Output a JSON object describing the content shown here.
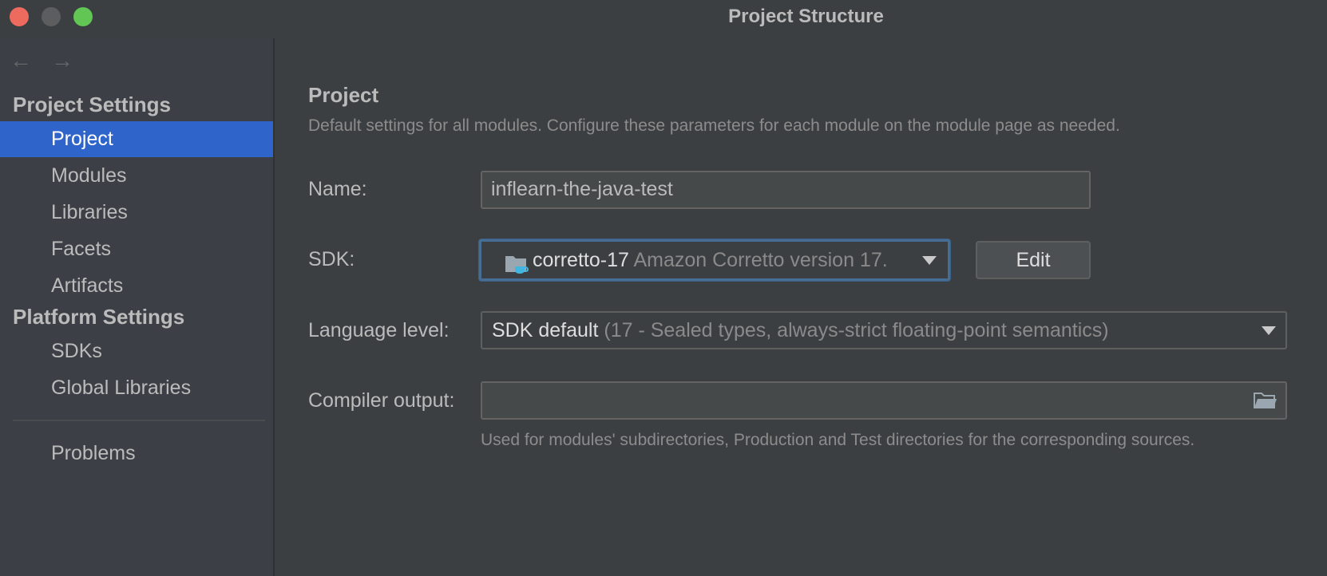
{
  "window": {
    "title": "Project Structure"
  },
  "nav": {
    "back_icon": "arrow-left-icon",
    "forward_icon": "arrow-right-icon"
  },
  "sidebar": {
    "project_settings_header": "Project Settings",
    "project_settings_items": [
      {
        "label": "Project",
        "selected": true
      },
      {
        "label": "Modules",
        "selected": false
      },
      {
        "label": "Libraries",
        "selected": false
      },
      {
        "label": "Facets",
        "selected": false
      },
      {
        "label": "Artifacts",
        "selected": false
      }
    ],
    "platform_settings_header": "Platform Settings",
    "platform_settings_items": [
      {
        "label": "SDKs"
      },
      {
        "label": "Global Libraries"
      }
    ],
    "problems_label": "Problems"
  },
  "main": {
    "title": "Project",
    "description": "Default settings for all modules. Configure these parameters for each module on the module page as needed.",
    "name_label": "Name:",
    "name_value": "inflearn-the-java-test",
    "sdk_label": "SDK:",
    "sdk_primary": "corretto-17",
    "sdk_secondary": "Amazon Corretto version 17.",
    "sdk_icon": "jdk-folder-icon",
    "edit_button": "Edit",
    "language_level_label": "Language level:",
    "language_level_primary": "SDK default",
    "language_level_secondary": "(17 - Sealed types, always-strict floating-point semantics)",
    "compiler_output_label": "Compiler output:",
    "compiler_output_value": "",
    "compiler_output_hint": "Used for modules' subdirectories, Production and Test directories for the corresponding sources."
  },
  "colors": {
    "selection": "#2f65ca",
    "background": "#3c3f41",
    "sidebar_background": "#3c4046",
    "focus_border": "#466d94"
  }
}
